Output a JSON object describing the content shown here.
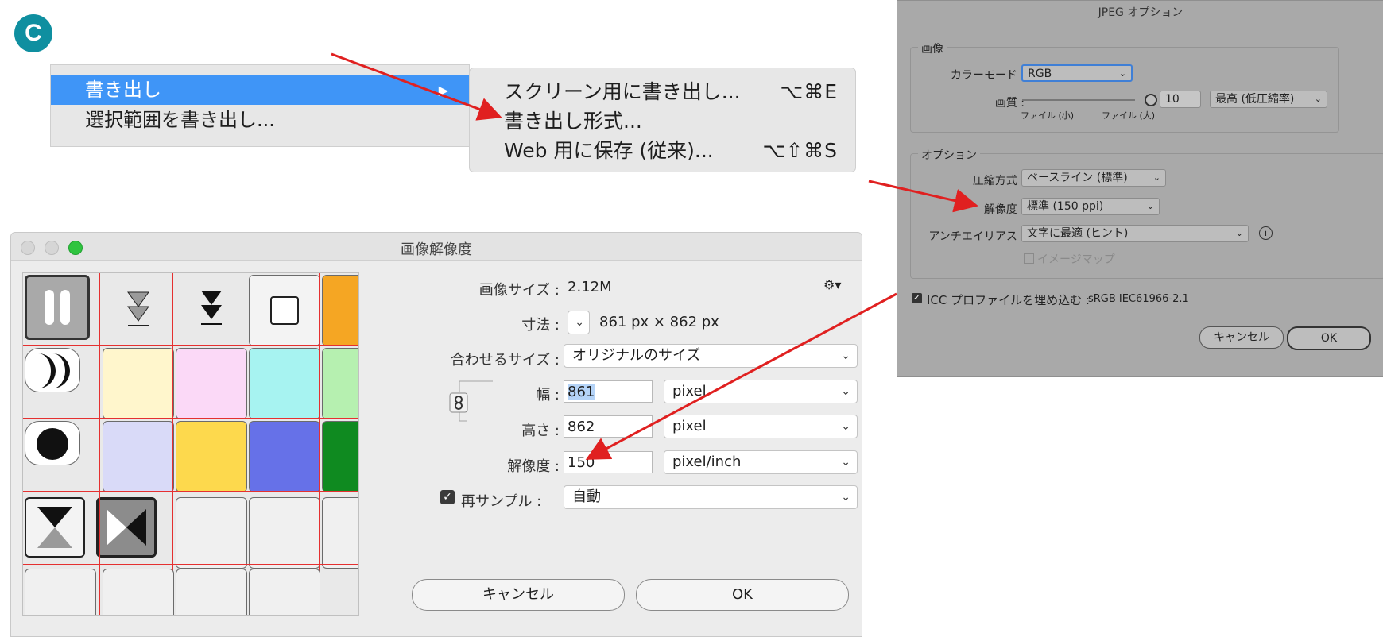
{
  "badge": "C",
  "menu": {
    "items": [
      {
        "label": "書き出し",
        "arrow": "▶"
      },
      {
        "label": "選択範囲を書き出し..."
      }
    ],
    "submenu": [
      {
        "label": "スクリーン用に書き出し...",
        "shortcut": "⌥⌘E"
      },
      {
        "label": "書き出し形式..."
      },
      {
        "label": "Web 用に保存 (従来)...",
        "shortcut": "⌥⇧⌘S"
      }
    ]
  },
  "resolution_dialog": {
    "title": "画像解像度",
    "image_size_label": "画像サイズ :",
    "image_size": "2.12M",
    "dimensions_label": "寸法 :",
    "dimensions": "861 px × 862 px",
    "fit_label": "合わせるサイズ :",
    "fit_value": "オリジナルのサイズ",
    "width_label": "幅 :",
    "width_value": "861",
    "width_unit": "pixel",
    "height_label": "高さ :",
    "height_value": "862",
    "height_unit": "pixel",
    "resolution_label": "解像度 :",
    "resolution_value": "150",
    "resolution_unit": "pixel/inch",
    "resample_label": "再サンプル :",
    "resample_value": "自動",
    "cancel": "キャンセル",
    "ok": "OK"
  },
  "jpeg_dialog": {
    "title": "JPEG オプション",
    "image_group": "画像",
    "color_mode_label": "カラーモード :",
    "color_mode": "RGB",
    "quality_label": "画質 :",
    "quality_value": "10",
    "quality_small": "ファイル (小)",
    "quality_large": "ファイル (大)",
    "quality_preset": "最高 (低圧縮率)",
    "options_group": "オプション",
    "compression_label": "圧縮方式 :",
    "compression": "ベースライン (標準)",
    "resolution_label": "解像度 :",
    "resolution": "標準 (150 ppi)",
    "antialias_label": "アンチエイリアス :",
    "antialias": "文字に最適 (ヒント)",
    "imagemap": "イメージマップ",
    "icc_label": "ICC プロファイルを埋め込む :",
    "icc_profile": "sRGB IEC61966-2.1",
    "cancel": "キャンセル",
    "ok": "OK"
  },
  "colors": {
    "menu_highlight": "#3f95f7",
    "arrow": "#e02020",
    "badge": "#0f8fa0",
    "grid_line": "#e53030"
  },
  "swatches": [
    "#fff6cc",
    "#fbd9f7",
    "#a7f3f1",
    "#d9daf8",
    "#fdd94d",
    "#6671e8"
  ]
}
